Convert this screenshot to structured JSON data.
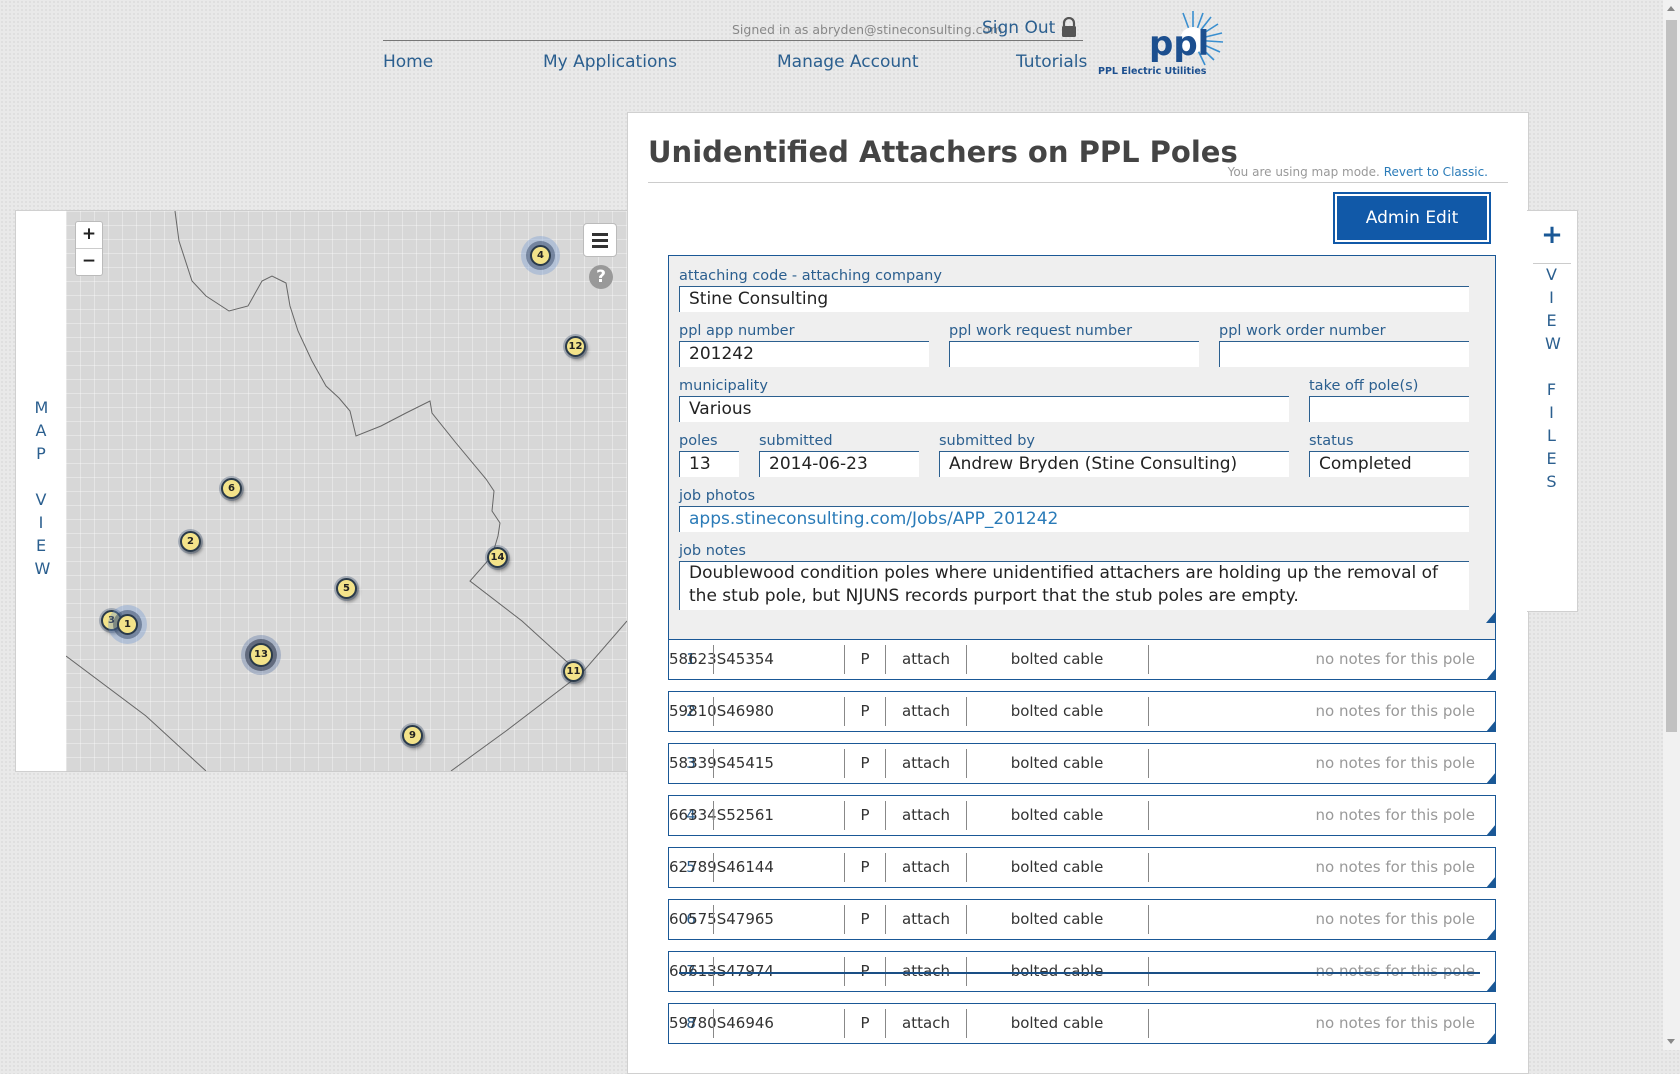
{
  "header": {
    "signed_in": "Signed in as abryden@stineconsulting.com",
    "sign_out": "Sign Out",
    "nav": [
      "Home",
      "My Applications",
      "Manage Account",
      "Tutorials"
    ],
    "logo_text": "ppl",
    "logo_sub": "PPL Electric Utilities"
  },
  "map": {
    "tab_label_top": "MAP",
    "tab_label_bottom": "VIEW",
    "zoom_in": "+",
    "zoom_out": "−",
    "help": "?",
    "markers": [
      "4",
      "12",
      "6",
      "2",
      "14",
      "5",
      "3",
      "1",
      "13",
      "11",
      "9"
    ]
  },
  "page": {
    "title": "Unidentified Attachers on PPL Poles",
    "mode_text": "You are using map mode.",
    "revert_link": "Revert to Classic.",
    "admin_edit": "Admin Edit"
  },
  "form": {
    "attaching_code": {
      "label": "attaching code - attaching company",
      "value": "Stine Consulting"
    },
    "app_number": {
      "label": "ppl app number",
      "value": "201242"
    },
    "work_request": {
      "label": "ppl work request number",
      "value": ""
    },
    "work_order": {
      "label": "ppl work order number",
      "value": ""
    },
    "municipality": {
      "label": "municipality",
      "value": "Various"
    },
    "take_off": {
      "label": "take off pole(s)",
      "value": ""
    },
    "poles": {
      "label": "poles",
      "value": "13"
    },
    "submitted": {
      "label": "submitted",
      "value": "2014-06-23"
    },
    "submitted_by": {
      "label": "submitted by",
      "value": "Andrew Bryden (Stine Consulting)"
    },
    "status": {
      "label": "status",
      "value": "Completed"
    },
    "job_photos": {
      "label": "job photos",
      "value": "apps.stineconsulting.com/Jobs/APP_201242"
    },
    "job_notes": {
      "label": "job notes",
      "value": "Doublewood condition poles where unidentified attachers are holding up the removal of the stub pole, but NJUNS records purport that the stub poles are empty."
    }
  },
  "poles": [
    {
      "num": "1",
      "id": "58623S45354",
      "pt": "P",
      "action": "attach",
      "type": "bolted cable",
      "note": "no notes for this pole"
    },
    {
      "num": "2",
      "id": "59810S46980",
      "pt": "P",
      "action": "attach",
      "type": "bolted cable",
      "note": "no notes for this pole"
    },
    {
      "num": "3",
      "id": "58339S45415",
      "pt": "P",
      "action": "attach",
      "type": "bolted cable",
      "note": "no notes for this pole"
    },
    {
      "num": "4",
      "id": "66334S52561",
      "pt": "P",
      "action": "attach",
      "type": "bolted cable",
      "note": "no notes for this pole"
    },
    {
      "num": "5",
      "id": "62789S46144",
      "pt": "P",
      "action": "attach",
      "type": "bolted cable",
      "note": "no notes for this pole"
    },
    {
      "num": "6",
      "id": "60575S47965",
      "pt": "P",
      "action": "attach",
      "type": "bolted cable",
      "note": "no notes for this pole"
    },
    {
      "num": "7",
      "id": "60613S47974",
      "pt": "P",
      "action": "attach",
      "type": "bolted cable",
      "note": "no notes for this pole",
      "struck": true
    },
    {
      "num": "8",
      "id": "59780S46946",
      "pt": "P",
      "action": "attach",
      "type": "bolted cable",
      "note": "no notes for this pole"
    }
  ],
  "files": {
    "plus": "+",
    "label_top": "VIEW",
    "label_bottom": "FILES"
  }
}
